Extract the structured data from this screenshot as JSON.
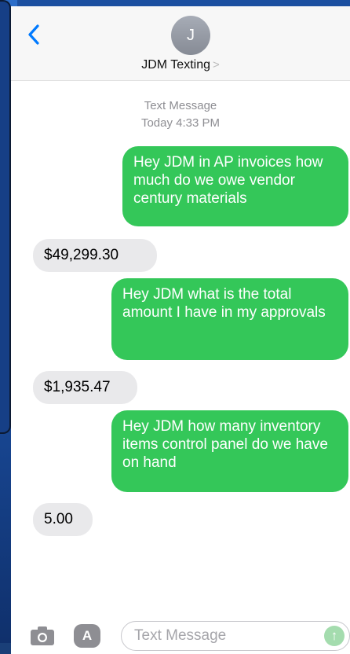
{
  "header": {
    "avatar_initial": "J",
    "contact_name": "JDM Texting",
    "contact_chevron": ">"
  },
  "thread": {
    "service_label": "Text Message",
    "timestamp": "Today 4:33 PM"
  },
  "messages": [
    {
      "direction": "outgoing",
      "text": "Hey JDM in AP invoices how much do we owe vendor century materials"
    },
    {
      "direction": "incoming",
      "text": "$49,299.30"
    },
    {
      "direction": "outgoing",
      "text": "Hey JDM what is the total amount I have in my approvals"
    },
    {
      "direction": "incoming",
      "text": "$1,935.47"
    },
    {
      "direction": "outgoing",
      "text": "Hey JDM how many inventory items control panel do we have on hand"
    },
    {
      "direction": "incoming",
      "text": "5.00"
    }
  ],
  "composer": {
    "placeholder": "Text Message",
    "apps_glyph": "A",
    "send_glyph": "↑"
  },
  "icons": [
    "back-chevron-icon",
    "camera-icon",
    "app-store-icon",
    "send-arrow-icon"
  ],
  "colors": {
    "outgoing_bubble": "#34c759",
    "incoming_bubble": "#e9e9eb",
    "accent": "#007aff"
  }
}
